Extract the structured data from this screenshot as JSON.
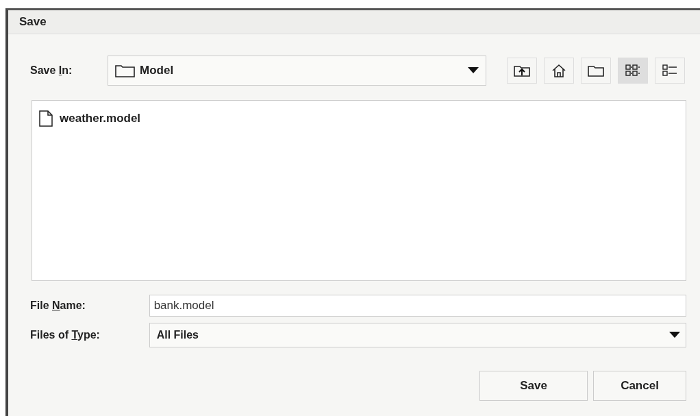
{
  "window": {
    "title": "Save"
  },
  "save_in": {
    "label": {
      "before": "Save ",
      "mnemonic": "I",
      "after": "n:"
    },
    "value": "Model"
  },
  "toolbar": [
    {
      "kind": "up"
    },
    {
      "kind": "home"
    },
    {
      "kind": "new-folder"
    },
    {
      "kind": "list-view",
      "selected": true
    },
    {
      "kind": "details-view",
      "selected": false
    }
  ],
  "files": [
    {
      "name": "weather.model"
    }
  ],
  "file_name": {
    "label": {
      "before": "File ",
      "mnemonic": "N",
      "after": "ame:"
    },
    "value": "bank.model"
  },
  "file_type": {
    "label": {
      "before": "Files of ",
      "mnemonic": "T",
      "after": "ype:"
    },
    "value": "All Files"
  },
  "buttons": [
    {
      "label": "Save"
    },
    {
      "label": "Cancel"
    }
  ]
}
